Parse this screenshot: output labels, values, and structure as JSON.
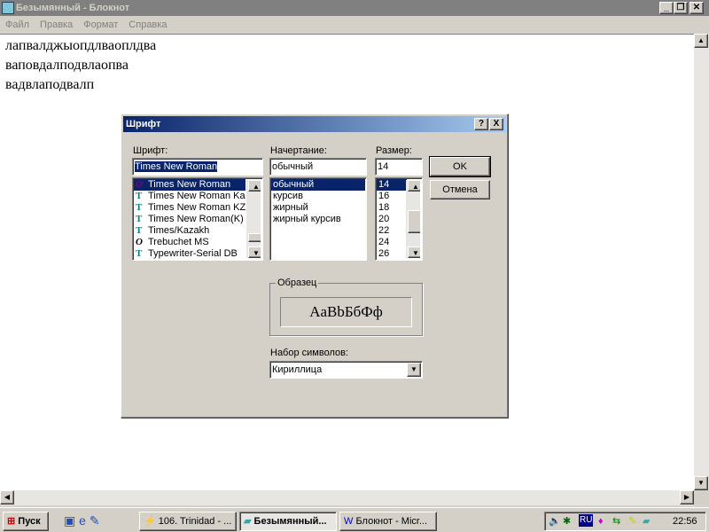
{
  "window": {
    "title": "Безымянный - Блокнот",
    "menu": [
      "Файл",
      "Правка",
      "Формат",
      "Справка"
    ],
    "text_lines": [
      "лапвалджыопдлваоплдва",
      "ваповдалподвлаопва",
      "вадвлаподвалп"
    ]
  },
  "dialog": {
    "title": "Шрифт",
    "help": "?",
    "close": "X",
    "font_label": "Шрифт:",
    "font_value": "Times New Roman",
    "fonts": [
      "Times New Roman",
      "Times New Roman Ka",
      "Times New Roman KZ",
      "Times New Roman(K)",
      "Times/Kazakh",
      "Trebuchet MS",
      "Typewriter-Serial DB"
    ],
    "style_label": "Начертание:",
    "style_value": "обычный",
    "styles": [
      "обычный",
      "курсив",
      "жирный",
      "жирный курсив"
    ],
    "size_label": "Размер:",
    "size_value": "14",
    "sizes": [
      "14",
      "16",
      "18",
      "20",
      "22",
      "24",
      "26"
    ],
    "ok": "OK",
    "cancel": "Отмена",
    "sample_label": "Образец",
    "sample_text": "AaBbБбФф",
    "charset_label": "Набор символов:",
    "charset_value": "Кириллица"
  },
  "taskbar": {
    "start": "Пуск",
    "tasks": [
      "106. Trinidad - ...",
      "Безымянный...",
      "Блокнот - Micr..."
    ],
    "lang": "RU",
    "clock": "22:56"
  }
}
